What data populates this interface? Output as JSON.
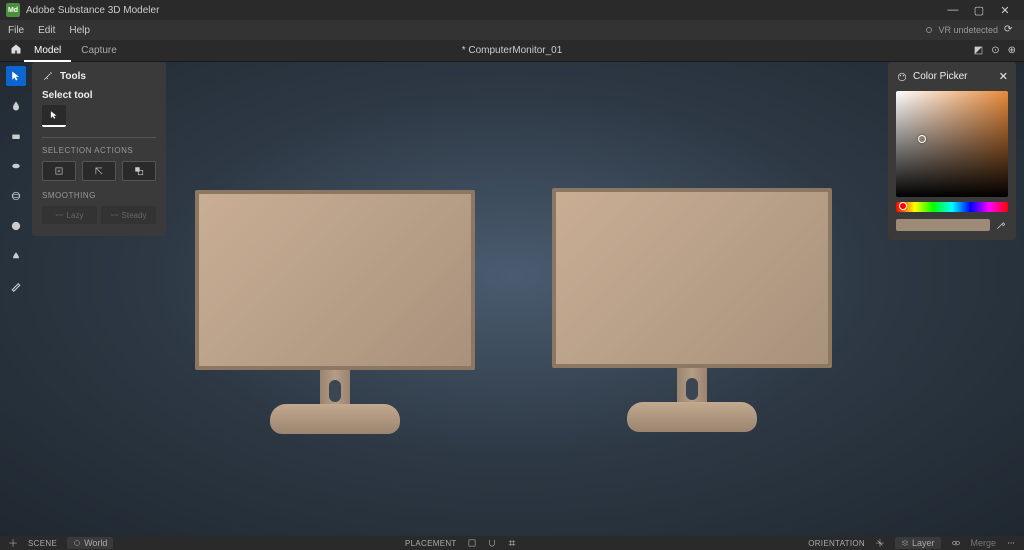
{
  "app_title": "Adobe Substance 3D Modeler",
  "menu": {
    "file": "File",
    "edit": "Edit",
    "help": "Help",
    "vr_status": "VR undetected"
  },
  "tabs": {
    "model": "Model",
    "capture": "Capture"
  },
  "document_name": "* ComputerMonitor_01",
  "tools_panel": {
    "title": "Tools",
    "select_tool_label": "Select tool",
    "selection_actions_label": "SELECTION ACTIONS",
    "smoothing_label": "SMOOTHING",
    "lazy": "Lazy",
    "steady": "Steady"
  },
  "color_picker": {
    "title": "Color Picker",
    "selected_hex": "#9d8a77",
    "hue_deg": 24,
    "sat": 0.22,
    "val": 0.56
  },
  "bottom_bar": {
    "scene": "SCENE",
    "world": "World",
    "placement": "PLACEMENT",
    "orientation": "ORIENTATION",
    "layer": "Layer",
    "merge": "Merge"
  },
  "icons": {
    "select": "▲",
    "brush": "✎",
    "eraser": "◧",
    "smooth": "◐",
    "sphere": "⬤",
    "flatten": "▬",
    "pinch": "◆",
    "paint": "✎"
  }
}
